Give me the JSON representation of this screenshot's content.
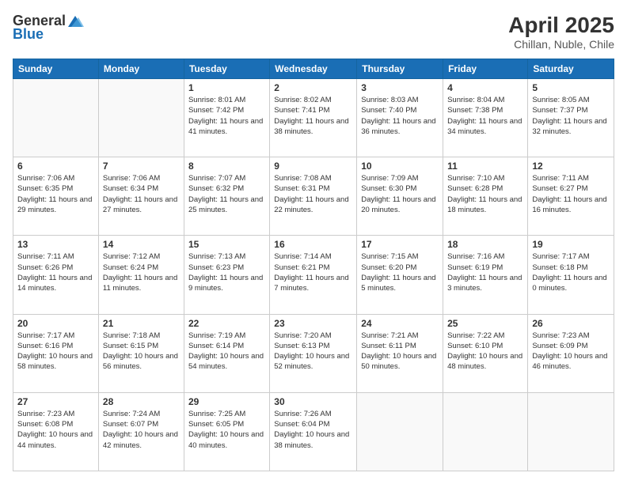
{
  "logo": {
    "general": "General",
    "blue": "Blue"
  },
  "header": {
    "month": "April 2025",
    "location": "Chillan, Nuble, Chile"
  },
  "days_of_week": [
    "Sunday",
    "Monday",
    "Tuesday",
    "Wednesday",
    "Thursday",
    "Friday",
    "Saturday"
  ],
  "weeks": [
    [
      {
        "day": "",
        "info": ""
      },
      {
        "day": "",
        "info": ""
      },
      {
        "day": "1",
        "info": "Sunrise: 8:01 AM\nSunset: 7:42 PM\nDaylight: 11 hours and 41 minutes."
      },
      {
        "day": "2",
        "info": "Sunrise: 8:02 AM\nSunset: 7:41 PM\nDaylight: 11 hours and 38 minutes."
      },
      {
        "day": "3",
        "info": "Sunrise: 8:03 AM\nSunset: 7:40 PM\nDaylight: 11 hours and 36 minutes."
      },
      {
        "day": "4",
        "info": "Sunrise: 8:04 AM\nSunset: 7:38 PM\nDaylight: 11 hours and 34 minutes."
      },
      {
        "day": "5",
        "info": "Sunrise: 8:05 AM\nSunset: 7:37 PM\nDaylight: 11 hours and 32 minutes."
      }
    ],
    [
      {
        "day": "6",
        "info": "Sunrise: 7:06 AM\nSunset: 6:35 PM\nDaylight: 11 hours and 29 minutes."
      },
      {
        "day": "7",
        "info": "Sunrise: 7:06 AM\nSunset: 6:34 PM\nDaylight: 11 hours and 27 minutes."
      },
      {
        "day": "8",
        "info": "Sunrise: 7:07 AM\nSunset: 6:32 PM\nDaylight: 11 hours and 25 minutes."
      },
      {
        "day": "9",
        "info": "Sunrise: 7:08 AM\nSunset: 6:31 PM\nDaylight: 11 hours and 22 minutes."
      },
      {
        "day": "10",
        "info": "Sunrise: 7:09 AM\nSunset: 6:30 PM\nDaylight: 11 hours and 20 minutes."
      },
      {
        "day": "11",
        "info": "Sunrise: 7:10 AM\nSunset: 6:28 PM\nDaylight: 11 hours and 18 minutes."
      },
      {
        "day": "12",
        "info": "Sunrise: 7:11 AM\nSunset: 6:27 PM\nDaylight: 11 hours and 16 minutes."
      }
    ],
    [
      {
        "day": "13",
        "info": "Sunrise: 7:11 AM\nSunset: 6:26 PM\nDaylight: 11 hours and 14 minutes."
      },
      {
        "day": "14",
        "info": "Sunrise: 7:12 AM\nSunset: 6:24 PM\nDaylight: 11 hours and 11 minutes."
      },
      {
        "day": "15",
        "info": "Sunrise: 7:13 AM\nSunset: 6:23 PM\nDaylight: 11 hours and 9 minutes."
      },
      {
        "day": "16",
        "info": "Sunrise: 7:14 AM\nSunset: 6:21 PM\nDaylight: 11 hours and 7 minutes."
      },
      {
        "day": "17",
        "info": "Sunrise: 7:15 AM\nSunset: 6:20 PM\nDaylight: 11 hours and 5 minutes."
      },
      {
        "day": "18",
        "info": "Sunrise: 7:16 AM\nSunset: 6:19 PM\nDaylight: 11 hours and 3 minutes."
      },
      {
        "day": "19",
        "info": "Sunrise: 7:17 AM\nSunset: 6:18 PM\nDaylight: 11 hours and 0 minutes."
      }
    ],
    [
      {
        "day": "20",
        "info": "Sunrise: 7:17 AM\nSunset: 6:16 PM\nDaylight: 10 hours and 58 minutes."
      },
      {
        "day": "21",
        "info": "Sunrise: 7:18 AM\nSunset: 6:15 PM\nDaylight: 10 hours and 56 minutes."
      },
      {
        "day": "22",
        "info": "Sunrise: 7:19 AM\nSunset: 6:14 PM\nDaylight: 10 hours and 54 minutes."
      },
      {
        "day": "23",
        "info": "Sunrise: 7:20 AM\nSunset: 6:13 PM\nDaylight: 10 hours and 52 minutes."
      },
      {
        "day": "24",
        "info": "Sunrise: 7:21 AM\nSunset: 6:11 PM\nDaylight: 10 hours and 50 minutes."
      },
      {
        "day": "25",
        "info": "Sunrise: 7:22 AM\nSunset: 6:10 PM\nDaylight: 10 hours and 48 minutes."
      },
      {
        "day": "26",
        "info": "Sunrise: 7:23 AM\nSunset: 6:09 PM\nDaylight: 10 hours and 46 minutes."
      }
    ],
    [
      {
        "day": "27",
        "info": "Sunrise: 7:23 AM\nSunset: 6:08 PM\nDaylight: 10 hours and 44 minutes."
      },
      {
        "day": "28",
        "info": "Sunrise: 7:24 AM\nSunset: 6:07 PM\nDaylight: 10 hours and 42 minutes."
      },
      {
        "day": "29",
        "info": "Sunrise: 7:25 AM\nSunset: 6:05 PM\nDaylight: 10 hours and 40 minutes."
      },
      {
        "day": "30",
        "info": "Sunrise: 7:26 AM\nSunset: 6:04 PM\nDaylight: 10 hours and 38 minutes."
      },
      {
        "day": "",
        "info": ""
      },
      {
        "day": "",
        "info": ""
      },
      {
        "day": "",
        "info": ""
      }
    ]
  ]
}
